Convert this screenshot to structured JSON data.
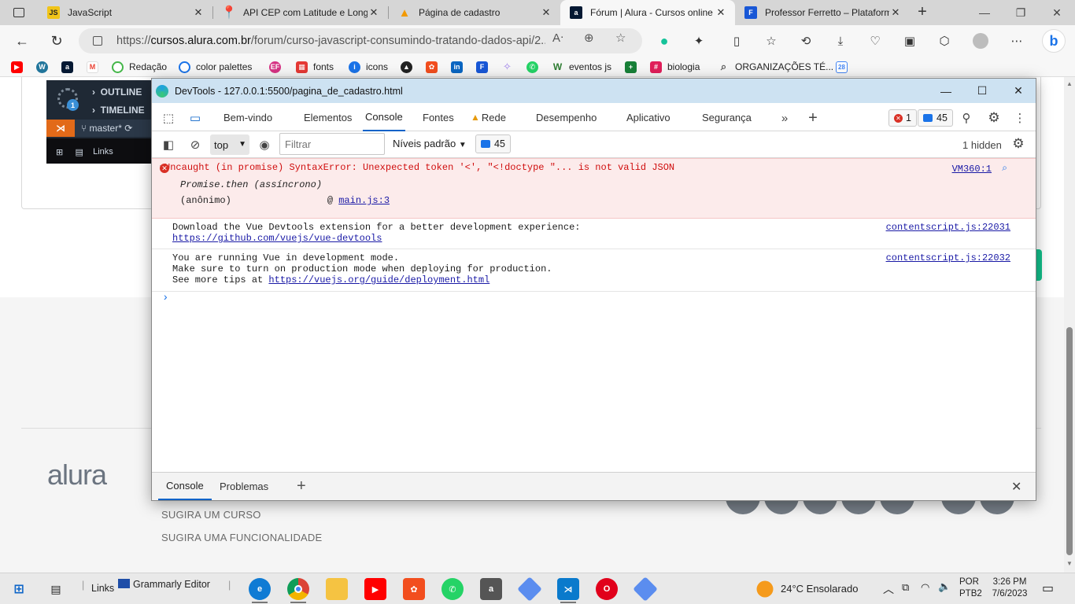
{
  "browser": {
    "tabs": [
      {
        "title": "JavaScript",
        "fav_color": "#f0c419",
        "fav_text": "JS"
      },
      {
        "title": "API CEP com Latitude e Longi",
        "fav_color": "#1a73e8",
        "fav_text": ""
      },
      {
        "title": "Página de cadastro",
        "fav_color": "#f29900",
        "fav_text": ""
      },
      {
        "title": "Fórum | Alura - Cursos online",
        "fav_color": "#051933",
        "fav_text": "a"
      },
      {
        "title": "Professor Ferretto – Plataform",
        "fav_color": "#1857d6",
        "fav_text": "F"
      }
    ],
    "active_tab_index": 3,
    "url_host": "cursos.alura.com.br",
    "url_prefix": "https://",
    "url_path": "/forum/curso-javascript-consumindo-tratando-dados-api/2...",
    "bookmarks": [
      {
        "label": "",
        "color": "#ff0000"
      },
      {
        "label": "",
        "color": "#21759b"
      },
      {
        "label": "",
        "color": "#051933",
        "text": "a"
      },
      {
        "label": "",
        "color": "#ea4335",
        "text": "M"
      },
      {
        "label": "Redação",
        "color": "#44b649"
      },
      {
        "label": "color palettes",
        "color": "#1a73e8"
      },
      {
        "label": "",
        "color": "#d63384",
        "text": "EF"
      },
      {
        "label": "fonts",
        "color": "#e53935"
      },
      {
        "label": "icons",
        "color": "#1a73e8",
        "text": "i"
      },
      {
        "label": "",
        "color": "#222222"
      },
      {
        "label": "",
        "color": "#f24e1e"
      },
      {
        "label": "",
        "color": "#0a66c2",
        "text": "in"
      },
      {
        "label": "",
        "color": "#1857d6",
        "text": "F"
      },
      {
        "label": "",
        "color": "#9c7dea"
      },
      {
        "label": "",
        "color": "#25d366"
      },
      {
        "label": "eventos js",
        "color": "#2e7d32",
        "text": "W"
      },
      {
        "label": "",
        "color": "#188038",
        "text": "+"
      },
      {
        "label": "biologia",
        "color": "#e01e5a",
        "text": "#"
      },
      {
        "label": "ORGANIZAÇÕES TÉ...",
        "color": "#555555"
      },
      {
        "label": "",
        "color": "#4285f4",
        "text": "28"
      }
    ]
  },
  "page": {
    "vscode": {
      "outline": "OUTLINE",
      "timeline": "TIMELINE",
      "branch": "master*",
      "links": "Links",
      "badge": "1"
    },
    "logo": "alura",
    "footer_links": [
      "SUGIRA UM CURSO",
      "SUGIRA UMA FUNCIONALIDADE"
    ]
  },
  "devtools": {
    "title": "DevTools - 127.0.0.1:5500/pagina_de_cadastro.html",
    "tabs": [
      "Bem-vindo",
      "Elementos",
      "Console",
      "Fontes",
      "Rede",
      "Desempenho",
      "Aplicativo",
      "Segurança"
    ],
    "active_tab": "Console",
    "error_count": "1",
    "message_count": "45",
    "context": "top",
    "filter_placeholder": "Filtrar",
    "levels": "Níveis padrão",
    "toolbar_msg_count": "45",
    "hidden": "1 hidden",
    "messages": {
      "error_text": "Uncaught (in promise) SyntaxError: Unexpected token '<', \"<!doctype \"... is not valid JSON",
      "error_src": "VM360:1",
      "error_stack1": "Promise.then (assíncrono)",
      "error_stack2_fn": "(anônimo)",
      "error_stack2_at": "@",
      "error_stack2_src": "main.js:3",
      "vue1_line1": "Download the Vue Devtools extension for a better development experience:",
      "vue1_link": "https://github.com/vuejs/vue-devtools",
      "vue1_src": "contentscript.js:22031",
      "vue2_line1": "You are running Vue in development mode.",
      "vue2_line2": "Make sure to turn on production mode when deploying for production.",
      "vue2_line3_prefix": "See more tips at",
      "vue2_link": "https://vuejs.org/guide/deployment.html",
      "vue2_src": "contentscript.js:22032"
    },
    "drawer_tabs": [
      "Console",
      "Problemas"
    ]
  },
  "taskbar": {
    "links": "Links",
    "grammarly": "Grammarly Editor",
    "weather": "24°C  Ensolarado",
    "lang1": "POR",
    "lang2": "PTB2",
    "time": "3:26 PM",
    "date": "7/6/2023"
  }
}
